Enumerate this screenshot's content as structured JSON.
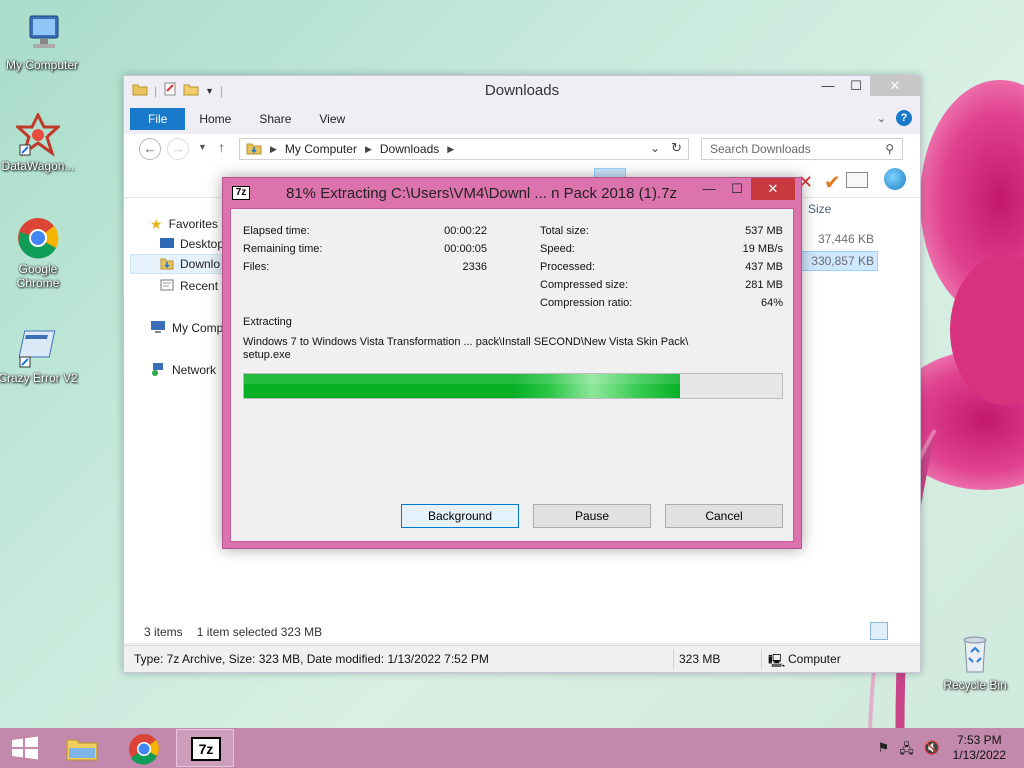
{
  "desktop": {
    "icons": [
      {
        "label": "My Computer"
      },
      {
        "label": "DataWagon..."
      },
      {
        "label": "Google\nChrome"
      },
      {
        "label": "Crazy Error V2"
      },
      {
        "label": "Recycle Bin"
      }
    ]
  },
  "explorer": {
    "title": "Downloads",
    "tabs": [
      "File",
      "Home",
      "Share",
      "View"
    ],
    "breadcrumb": [
      "My Computer",
      "Downloads"
    ],
    "search_placeholder": "Search Downloads",
    "nav": {
      "favorites": "Favorites",
      "desktop": "Desktop",
      "downloads": "Downlo",
      "recent": "Recent p",
      "my_computer": "My Comp",
      "network": "Network"
    },
    "size_header": "Size",
    "sizes": [
      "37,446 KB",
      "330,857 KB"
    ],
    "status": {
      "items": "3 items",
      "selected": "1 item selected  323 MB",
      "details": "Type: 7z Archive, Size: 323 MB, Date modified: 1/13/2022 7:52 PM",
      "size": "323 MB",
      "location": "Computer"
    }
  },
  "dialog": {
    "app_logo": "7z",
    "title": "81% Extracting C:\\Users\\VM4\\Downl ... n Pack 2018 (1).7z",
    "left": [
      {
        "label": "Elapsed time:",
        "value": "00:00:22"
      },
      {
        "label": "Remaining time:",
        "value": "00:00:05"
      },
      {
        "label": "Files:",
        "value": "2336"
      }
    ],
    "right": [
      {
        "label": "Total size:",
        "value": "537 MB"
      },
      {
        "label": "Speed:",
        "value": "19 MB/s"
      },
      {
        "label": "Processed:",
        "value": "437 MB"
      },
      {
        "label": "Compressed size:",
        "value": "281 MB"
      },
      {
        "label": "Compression ratio:",
        "value": "64%"
      }
    ],
    "action": "Extracting",
    "current_file_line1": "Windows 7 to Windows Vista Transformation ... pack\\Install SECOND\\New Vista Skin Pack\\",
    "current_file_line2": "setup.exe",
    "progress": 0.81,
    "buttons": {
      "background": "Background",
      "pause": "Pause",
      "cancel": "Cancel"
    }
  },
  "taskbar": {
    "time": "7:53 PM",
    "date": "1/13/2022",
    "sevenzip_label": "7z"
  },
  "colors": {
    "accent": "#1979ca",
    "dialog_frame": "#dc73ad",
    "progress": "#06b025",
    "taskbar": "#c289ad"
  }
}
